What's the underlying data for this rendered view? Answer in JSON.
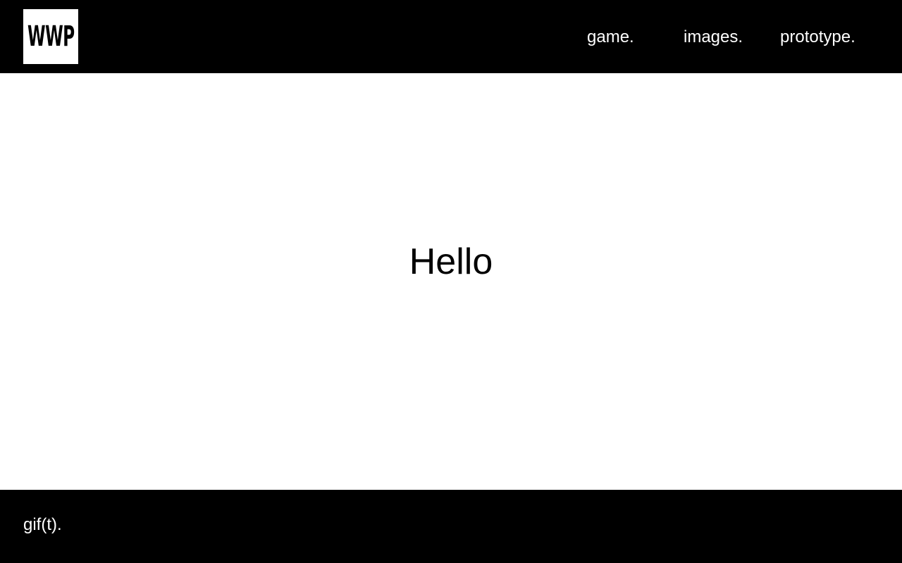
{
  "header": {
    "logo_text": "WWP",
    "nav": [
      {
        "label": "game."
      },
      {
        "label": "images."
      },
      {
        "label": "prototype."
      }
    ]
  },
  "main": {
    "heading": "Hello"
  },
  "footer": {
    "text": "gif(t)."
  },
  "colors": {
    "header_bg": "#000000",
    "footer_bg": "#000000",
    "page_bg": "#ffffff",
    "nav_text": "#ffffff",
    "heading_text": "#000000"
  }
}
